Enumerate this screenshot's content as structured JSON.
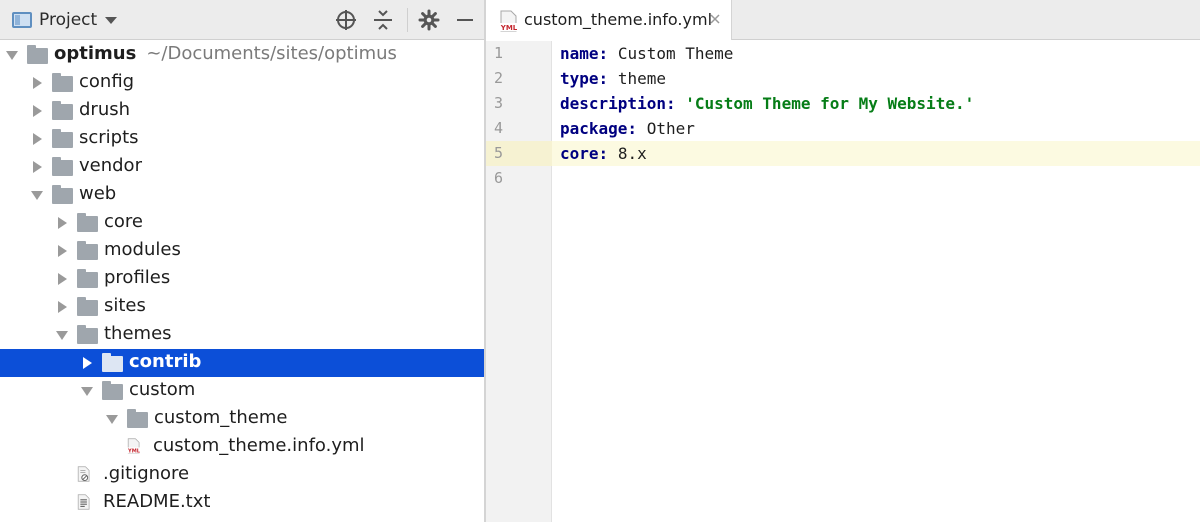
{
  "colors": {
    "selection": "#0c4fd8",
    "folder": "#9fa6ad",
    "yaml_key": "#000080",
    "yaml_string": "#067d17",
    "caret_line": "#fcfae1"
  },
  "project_panel": {
    "title": "Project",
    "toolbar_icons": [
      "locate-icon",
      "collapse-all-icon",
      "gear-icon",
      "minimize-icon"
    ],
    "tree": [
      {
        "label": "optimus",
        "path": "~/Documents/sites/optimus",
        "depth": 0,
        "type": "folder",
        "expanded": true
      },
      {
        "label": "config",
        "depth": 1,
        "type": "folder",
        "expanded": false
      },
      {
        "label": "drush",
        "depth": 1,
        "type": "folder",
        "expanded": false
      },
      {
        "label": "scripts",
        "depth": 1,
        "type": "folder",
        "expanded": false
      },
      {
        "label": "vendor",
        "depth": 1,
        "type": "folder",
        "expanded": false
      },
      {
        "label": "web",
        "depth": 1,
        "type": "folder",
        "expanded": true
      },
      {
        "label": "core",
        "depth": 2,
        "type": "folder",
        "expanded": false
      },
      {
        "label": "modules",
        "depth": 2,
        "type": "folder",
        "expanded": false
      },
      {
        "label": "profiles",
        "depth": 2,
        "type": "folder",
        "expanded": false
      },
      {
        "label": "sites",
        "depth": 2,
        "type": "folder",
        "expanded": false
      },
      {
        "label": "themes",
        "depth": 2,
        "type": "folder",
        "expanded": true
      },
      {
        "label": "contrib",
        "depth": 3,
        "type": "folder",
        "expanded": false,
        "selected": true
      },
      {
        "label": "custom",
        "depth": 3,
        "type": "folder",
        "expanded": true
      },
      {
        "label": "custom_theme",
        "depth": 4,
        "type": "folder",
        "expanded": true
      },
      {
        "label": "custom_theme.info.yml",
        "depth": 5,
        "type": "yml-file"
      },
      {
        "label": ".gitignore",
        "depth": 3,
        "type": "ignore-file"
      },
      {
        "label": "README.txt",
        "depth": 3,
        "type": "text-file"
      }
    ]
  },
  "editor": {
    "tab": {
      "label": "custom_theme.info.yml",
      "icon": "yml-file-icon"
    },
    "caret_line": 5,
    "lines": [
      {
        "num": "1",
        "key": "name",
        "sep": ": ",
        "value": "Custom Theme",
        "value_type": "plain"
      },
      {
        "num": "2",
        "key": "type",
        "sep": ": ",
        "value": "theme",
        "value_type": "plain"
      },
      {
        "num": "3",
        "key": "description",
        "sep": ": ",
        "value": "'Custom Theme for My Website.'",
        "value_type": "string"
      },
      {
        "num": "4",
        "key": "package",
        "sep": ": ",
        "value": "Other",
        "value_type": "plain"
      },
      {
        "num": "5",
        "key": "core",
        "sep": ": ",
        "value": "8.x",
        "value_type": "plain"
      },
      {
        "num": "6",
        "key": "",
        "sep": "",
        "value": "",
        "value_type": "plain"
      }
    ]
  }
}
